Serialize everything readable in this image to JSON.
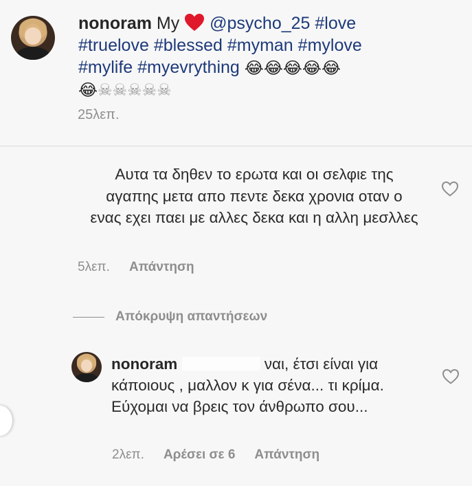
{
  "post": {
    "username": "nonoram",
    "text_before_heart": "My",
    "heart_icon": "red-heart-emoji",
    "mention": "@psycho_25",
    "hashtags": [
      "#love",
      "#truelove",
      "#blessed",
      "#myman",
      "#mylove",
      "#mylife",
      "#myevrything"
    ],
    "emoji_row1": [
      "😂",
      "😂",
      "😂",
      "😂",
      "😂"
    ],
    "emoji_row2": [
      "😂",
      "☠",
      "☠",
      "☠",
      "☠",
      "☠"
    ],
    "time": "25λεπ."
  },
  "comment": {
    "text": "Αυτα τα δηθεν το ερωτα και οι σελφιε της αγαπης μετα απο πεντε δεκα χρονια οταν ο ενας εχει παει με αλλες δεκα και η αλλη μεσλλες",
    "time": "5λεπ.",
    "reply_label": "Απάντηση",
    "like_icon": "heart-outline-icon"
  },
  "hide_replies": {
    "label": "Απόκρυψη απαντήσεων"
  },
  "reply": {
    "username": "nonoram",
    "text": " ναι, έτσι είναι για κάποιους , μαλλον κ για σένα... τι κρίμα. Εύχομαι να βρεις τον άνθρωπο σου...",
    "time": "2λεπ.",
    "likes_label": "Αρέσει σε 6",
    "reply_label": "Απάντηση",
    "like_icon": "heart-outline-icon"
  },
  "colors": {
    "background": "#f7f7f7",
    "text": "#262626",
    "muted": "#8e8e8e",
    "hashtag": "#1d3a7a",
    "heart": "#e0182b"
  }
}
